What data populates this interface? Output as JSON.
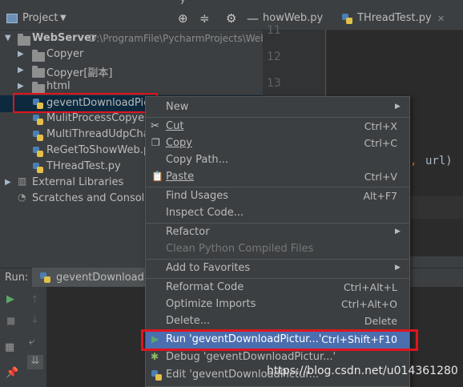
{
  "top": {
    "text": "y"
  },
  "project_panel": {
    "title": "Project",
    "header_icons": [
      "target-icon",
      "collapse-icon",
      "gear-icon",
      "minimize-icon"
    ],
    "root": {
      "label": "WebServer",
      "path": "D:\\ProgramFile\\PycharmProjects\\Web"
    },
    "folders": [
      "Copyer",
      "Copyer[副本]",
      "html"
    ],
    "files": [
      "geventDownloadPictur",
      "MulitProcessCopyer.p",
      "MultiThreadUdpChat.",
      "ReGetToShowWeb.py",
      "THreadTest.py"
    ],
    "external": "External Libraries",
    "scratches": "Scratches and Consoles"
  },
  "editor": {
    "tabs": [
      "howWeb.py",
      "THreadTest.py"
    ],
    "line_numbers": [
      "11",
      "12",
      "13"
    ],
    "code_fragment": {
      "comma": ",",
      "text": "url)"
    }
  },
  "run_panel": {
    "label": "Run:",
    "tab_label": "geventDownloadPic"
  },
  "context_menu": {
    "new": "New",
    "cut": {
      "label": "Cut",
      "shortcut": "Ctrl+X"
    },
    "copy": {
      "label": "Copy",
      "shortcut": "Ctrl+C"
    },
    "copy_path": "Copy Path...",
    "paste": {
      "label": "Paste",
      "shortcut": "Ctrl+V"
    },
    "find_usages": {
      "label": "Find Usages",
      "shortcut": "Alt+F7"
    },
    "inspect_code": "Inspect Code...",
    "refactor": "Refactor",
    "clean_compiled": "Clean Python Compiled Files",
    "add_favorites": "Add to Favorites",
    "reformat": {
      "label": "Reformat Code",
      "shortcut": "Ctrl+Alt+L"
    },
    "optimize": {
      "label": "Optimize Imports",
      "shortcut": "Ctrl+Alt+O"
    },
    "delete": {
      "label": "Delete...",
      "shortcut": "Delete"
    },
    "run": {
      "label": "Run 'geventDownloadPictur...'",
      "shortcut": "Ctrl+Shift+F10"
    },
    "debug": "Debug 'geventDownloadPictur...'",
    "edit": "Edit 'geventDownloadPictur..."
  },
  "watermark": "https://blog.csdn.net/u014361280",
  "colors": {
    "selection": "#4b6eaf",
    "highlight_box": "#e0141e",
    "panel": "#3c3f41",
    "editor": "#2b2b2b"
  }
}
